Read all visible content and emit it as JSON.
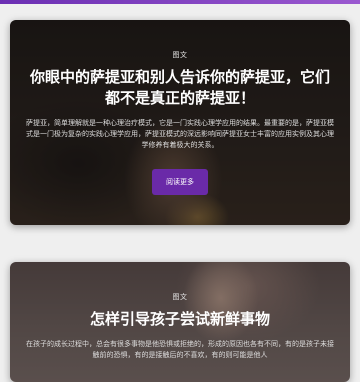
{
  "theme": {
    "accent": "#6a2aa8",
    "page_background": "#efefef"
  },
  "posts": [
    {
      "category": "图文",
      "title": "你眼中的萨提亚和别人告诉你的萨提亚，它们都不是真正的萨提亚！",
      "excerpt": "萨提亚，简单理解就是一种心理治疗模式，它是一门实践心理学应用的结果。最重要的是，萨提亚模式是一门极为复杂的实践心理学应用，萨提亚模式的深远影响同萨提亚女士丰富的应用实例及其心理学修养有着极大的关系。",
      "button_label": "阅读更多"
    },
    {
      "category": "图文",
      "title": "怎样引导孩子尝试新鲜事物",
      "excerpt": "在孩子的成长过程中，总会有很多事物是他恐惧或拒绝的，形成的原因也各有不同，有的是孩子未接触前的恐惧，有的是接触后的不喜欢，有的则可能是他人"
    }
  ]
}
